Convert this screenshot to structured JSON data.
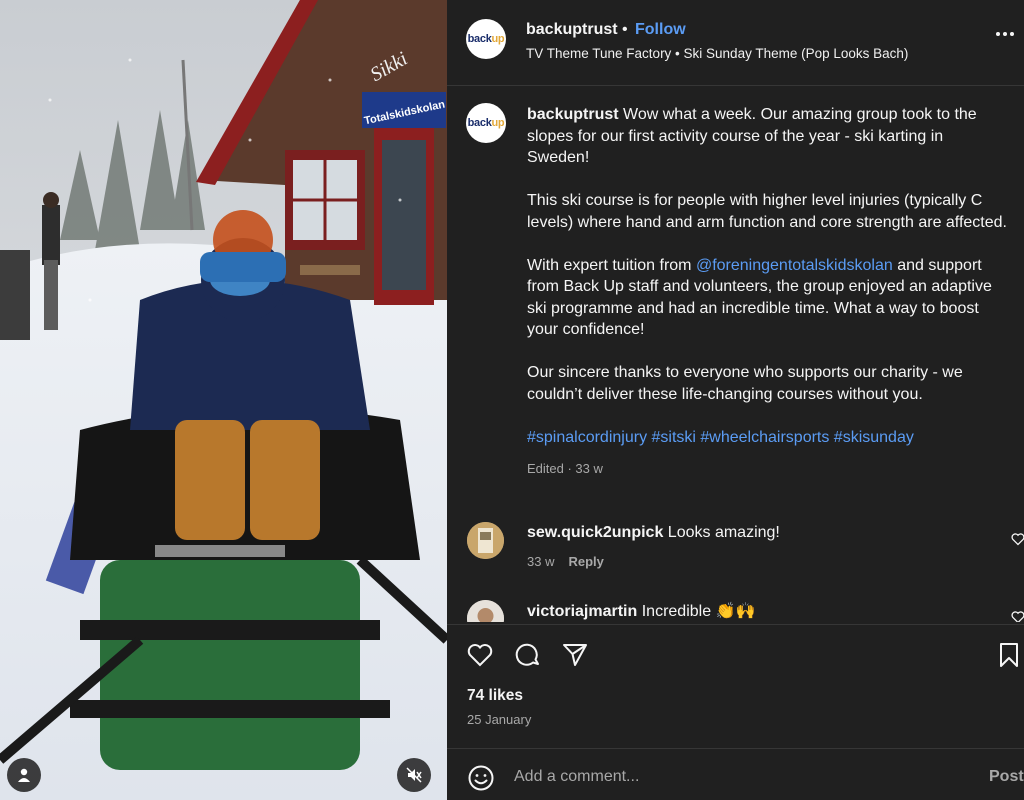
{
  "header": {
    "username": "backuptrust",
    "separator": "•",
    "follow_label": "Follow",
    "audio": "TV Theme Tune Factory • Ski Sunday Theme (Pop Looks Bach)",
    "avatar_logo": {
      "left": "back",
      "right": "up"
    }
  },
  "caption": {
    "username": "backuptrust",
    "paragraph1_text": "Wow what a week. Our amazing group took to the slopes for our first activity course of the year - ski karting in Sweden!",
    "paragraph2": "This ski course is for people with higher level injuries (typically C levels) where hand and arm function and core strength are affected.",
    "paragraph3_before": "With expert tuition from ",
    "paragraph3_mention": "@foreningentotalskidskolan",
    "paragraph3_after": " and support from Back Up staff and volunteers, the group enjoyed an adaptive ski programme and had an incredible time. What a way to boost your confidence!",
    "paragraph4": "Our sincere thanks to everyone who supports our charity - we couldn’t deliver these life-changing courses without you.",
    "hashtags": "#spinalcordinjury #sitski #wheelchairsports #skisunday",
    "meta": "Edited · 33 w"
  },
  "comments": [
    {
      "username": "sew.quick2unpick",
      "text": "Looks amazing!",
      "age": "33 w",
      "reply_label": "Reply"
    },
    {
      "username": "victoriajmartin",
      "text": "Incredible 👏🙌"
    }
  ],
  "likes": "74 likes",
  "date": "25 January",
  "add_comment": {
    "placeholder": "Add a comment...",
    "post_label": "Post"
  },
  "media": {
    "sign_top": "Sikki",
    "sign_brand": "Totalskidskolan"
  },
  "icons": {
    "like": "heart-icon",
    "comment": "comment-icon",
    "share": "paper-plane-icon",
    "save": "bookmark-icon",
    "more": "more-horizontal-icon",
    "emoji": "smiley-icon",
    "tag": "user-tag-icon",
    "mute": "muted-speaker-icon"
  },
  "colors": {
    "panel_bg": "#202020",
    "link": "#5b9cf4",
    "muted_text": "#a8a8a8",
    "text": "#f5f5f5"
  }
}
